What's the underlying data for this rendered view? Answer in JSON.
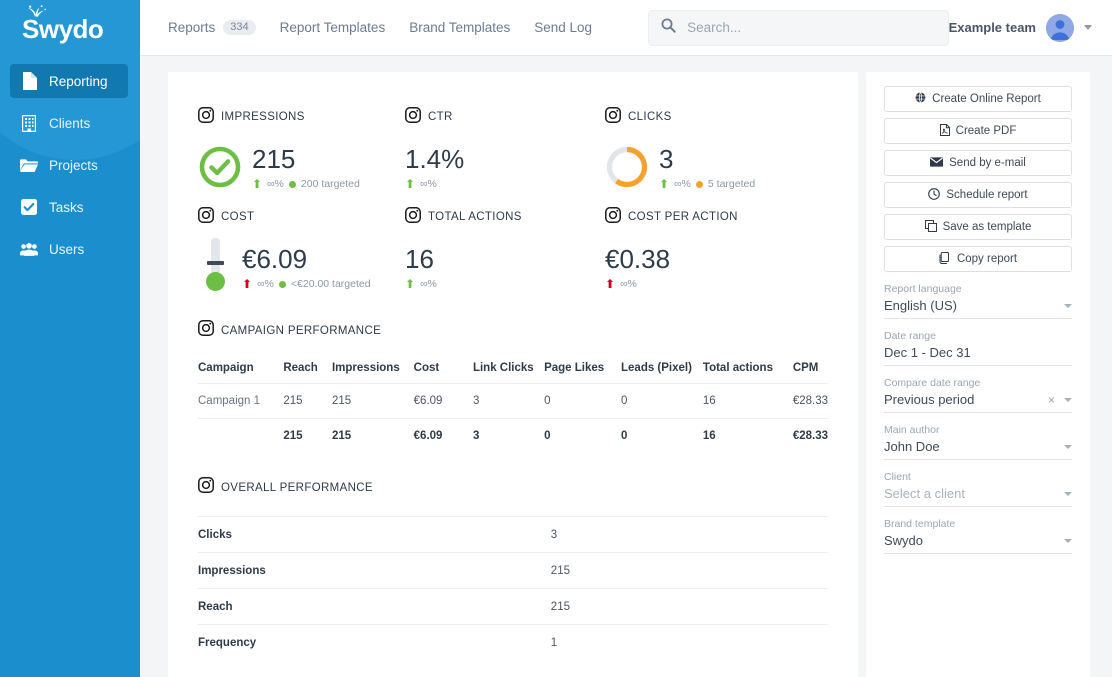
{
  "sidebar": {
    "logo": "Swydo",
    "items": [
      {
        "label": "Reporting",
        "icon": "document-icon",
        "active": true
      },
      {
        "label": "Clients",
        "icon": "building-icon",
        "active": false
      },
      {
        "label": "Projects",
        "icon": "folder-icon",
        "active": false
      },
      {
        "label": "Tasks",
        "icon": "checkbox-icon",
        "active": false
      },
      {
        "label": "Users",
        "icon": "users-icon",
        "active": false
      }
    ]
  },
  "topbar": {
    "nav": [
      {
        "label": "Reports",
        "count": "334"
      },
      {
        "label": "Report Templates",
        "count": ""
      },
      {
        "label": "Brand Templates",
        "count": ""
      },
      {
        "label": "Send Log",
        "count": ""
      }
    ],
    "search": {
      "placeholder": "Search...",
      "value": ""
    },
    "team": "Example team"
  },
  "kpis": [
    {
      "title": "IMPRESSIONS",
      "value": "215",
      "delta": "∞%",
      "delta_dir": "up",
      "delta_color": "#6cbe45",
      "target": "200 targeted",
      "target_color": "#6cbe45",
      "gauge": "check-ring",
      "gauge_color": "#6cbe45",
      "gauge_pct": 100
    },
    {
      "title": "CTR",
      "value": "1.4%",
      "delta": "∞%",
      "delta_dir": "up",
      "delta_color": "#6cbe45",
      "target": "",
      "target_color": "",
      "gauge": "none",
      "gauge_color": "",
      "gauge_pct": 0
    },
    {
      "title": "CLICKS",
      "value": "3",
      "delta": "∞%",
      "delta_dir": "up",
      "delta_color": "#6cbe45",
      "target": "5 targeted",
      "target_color": "#f5a12c",
      "gauge": "donut",
      "gauge_color": "#f5a12c",
      "gauge_pct": 60
    },
    {
      "title": "COST",
      "value": "€6.09",
      "delta": "∞%",
      "delta_dir": "down",
      "delta_color": "#d0021b",
      "target": "<€20.00 targeted",
      "target_color": "#6cbe45",
      "gauge": "thermometer",
      "gauge_color": "#6cbe45",
      "gauge_pct": 30
    },
    {
      "title": "TOTAL ACTIONS",
      "value": "16",
      "delta": "∞%",
      "delta_dir": "up",
      "delta_color": "#6cbe45",
      "target": "",
      "target_color": "",
      "gauge": "none",
      "gauge_color": "",
      "gauge_pct": 0
    },
    {
      "title": "COST PER ACTION",
      "value": "€0.38",
      "delta": "∞%",
      "delta_dir": "down",
      "delta_color": "#d0021b",
      "target": "",
      "target_color": "",
      "gauge": "none",
      "gauge_color": "",
      "gauge_pct": 0
    }
  ],
  "campaign_section": {
    "title": "CAMPAIGN PERFORMANCE",
    "columns": [
      "Campaign",
      "Reach",
      "Impressions",
      "Cost",
      "Link Clicks",
      "Page Likes",
      "Leads (Pixel)",
      "Total actions",
      "CPM"
    ],
    "rows": [
      [
        "Campaign 1",
        "215",
        "215",
        "€6.09",
        "3",
        "0",
        "0",
        "16",
        "€28.33"
      ]
    ],
    "total_row": [
      "",
      "215",
      "215",
      "€6.09",
      "3",
      "0",
      "0",
      "16",
      "€28.33"
    ]
  },
  "overall_section": {
    "title": "OVERALL PERFORMANCE",
    "rows": [
      {
        "key": "Clicks",
        "value": "3"
      },
      {
        "key": "Impressions",
        "value": "215"
      },
      {
        "key": "Reach",
        "value": "215"
      },
      {
        "key": "Frequency",
        "value": "1"
      }
    ]
  },
  "side": {
    "actions": [
      {
        "label": "Create Online Report",
        "icon": "globe-icon"
      },
      {
        "label": "Create PDF",
        "icon": "pdf-file-icon"
      },
      {
        "label": "Send by e-mail",
        "icon": "envelope-icon"
      },
      {
        "label": "Schedule report",
        "icon": "clock-icon"
      },
      {
        "label": "Save as template",
        "icon": "copy-icon"
      },
      {
        "label": "Copy report",
        "icon": "duplicate-icon"
      }
    ],
    "fields": [
      {
        "label": "Report language",
        "value": "English (US)",
        "placeholder": false,
        "clearable": false
      },
      {
        "label": "Date range",
        "value": "Dec 1 - Dec 31",
        "placeholder": false,
        "clearable": false,
        "no_caret": true
      },
      {
        "label": "Compare date range",
        "value": "Previous period",
        "placeholder": false,
        "clearable": true
      },
      {
        "label": "Main author",
        "value": "John Doe",
        "placeholder": false,
        "clearable": false
      },
      {
        "label": "Client",
        "value": "Select a client",
        "placeholder": true,
        "clearable": false
      },
      {
        "label": "Brand template",
        "value": "Swydo",
        "placeholder": false,
        "clearable": false
      }
    ]
  },
  "colors": {
    "sidebar_blue": "#1b8fce",
    "sidebar_active": "#1279b0",
    "green": "#6cbe45",
    "orange": "#f5a12c",
    "red": "#d0021b",
    "page_bg": "#f4f5f7"
  }
}
